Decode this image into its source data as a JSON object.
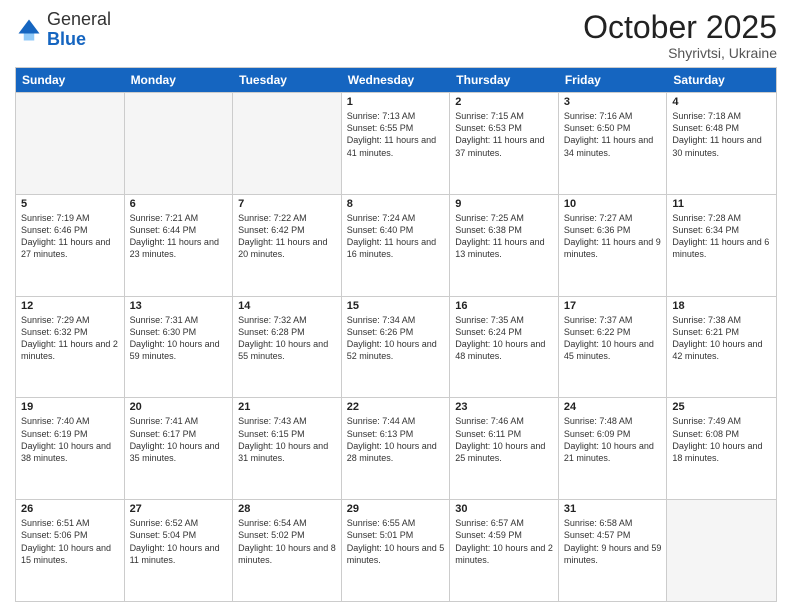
{
  "logo": {
    "general": "General",
    "blue": "Blue"
  },
  "header": {
    "month": "October 2025",
    "location": "Shyrivtsi, Ukraine"
  },
  "days": [
    "Sunday",
    "Monday",
    "Tuesday",
    "Wednesday",
    "Thursday",
    "Friday",
    "Saturday"
  ],
  "rows": [
    [
      {
        "day": "",
        "empty": true
      },
      {
        "day": "",
        "empty": true
      },
      {
        "day": "",
        "empty": true
      },
      {
        "day": "1",
        "sunrise": "Sunrise: 7:13 AM",
        "sunset": "Sunset: 6:55 PM",
        "daylight": "Daylight: 11 hours and 41 minutes."
      },
      {
        "day": "2",
        "sunrise": "Sunrise: 7:15 AM",
        "sunset": "Sunset: 6:53 PM",
        "daylight": "Daylight: 11 hours and 37 minutes."
      },
      {
        "day": "3",
        "sunrise": "Sunrise: 7:16 AM",
        "sunset": "Sunset: 6:50 PM",
        "daylight": "Daylight: 11 hours and 34 minutes."
      },
      {
        "day": "4",
        "sunrise": "Sunrise: 7:18 AM",
        "sunset": "Sunset: 6:48 PM",
        "daylight": "Daylight: 11 hours and 30 minutes."
      }
    ],
    [
      {
        "day": "5",
        "sunrise": "Sunrise: 7:19 AM",
        "sunset": "Sunset: 6:46 PM",
        "daylight": "Daylight: 11 hours and 27 minutes."
      },
      {
        "day": "6",
        "sunrise": "Sunrise: 7:21 AM",
        "sunset": "Sunset: 6:44 PM",
        "daylight": "Daylight: 11 hours and 23 minutes."
      },
      {
        "day": "7",
        "sunrise": "Sunrise: 7:22 AM",
        "sunset": "Sunset: 6:42 PM",
        "daylight": "Daylight: 11 hours and 20 minutes."
      },
      {
        "day": "8",
        "sunrise": "Sunrise: 7:24 AM",
        "sunset": "Sunset: 6:40 PM",
        "daylight": "Daylight: 11 hours and 16 minutes."
      },
      {
        "day": "9",
        "sunrise": "Sunrise: 7:25 AM",
        "sunset": "Sunset: 6:38 PM",
        "daylight": "Daylight: 11 hours and 13 minutes."
      },
      {
        "day": "10",
        "sunrise": "Sunrise: 7:27 AM",
        "sunset": "Sunset: 6:36 PM",
        "daylight": "Daylight: 11 hours and 9 minutes."
      },
      {
        "day": "11",
        "sunrise": "Sunrise: 7:28 AM",
        "sunset": "Sunset: 6:34 PM",
        "daylight": "Daylight: 11 hours and 6 minutes."
      }
    ],
    [
      {
        "day": "12",
        "sunrise": "Sunrise: 7:29 AM",
        "sunset": "Sunset: 6:32 PM",
        "daylight": "Daylight: 11 hours and 2 minutes."
      },
      {
        "day": "13",
        "sunrise": "Sunrise: 7:31 AM",
        "sunset": "Sunset: 6:30 PM",
        "daylight": "Daylight: 10 hours and 59 minutes."
      },
      {
        "day": "14",
        "sunrise": "Sunrise: 7:32 AM",
        "sunset": "Sunset: 6:28 PM",
        "daylight": "Daylight: 10 hours and 55 minutes."
      },
      {
        "day": "15",
        "sunrise": "Sunrise: 7:34 AM",
        "sunset": "Sunset: 6:26 PM",
        "daylight": "Daylight: 10 hours and 52 minutes."
      },
      {
        "day": "16",
        "sunrise": "Sunrise: 7:35 AM",
        "sunset": "Sunset: 6:24 PM",
        "daylight": "Daylight: 10 hours and 48 minutes."
      },
      {
        "day": "17",
        "sunrise": "Sunrise: 7:37 AM",
        "sunset": "Sunset: 6:22 PM",
        "daylight": "Daylight: 10 hours and 45 minutes."
      },
      {
        "day": "18",
        "sunrise": "Sunrise: 7:38 AM",
        "sunset": "Sunset: 6:21 PM",
        "daylight": "Daylight: 10 hours and 42 minutes."
      }
    ],
    [
      {
        "day": "19",
        "sunrise": "Sunrise: 7:40 AM",
        "sunset": "Sunset: 6:19 PM",
        "daylight": "Daylight: 10 hours and 38 minutes."
      },
      {
        "day": "20",
        "sunrise": "Sunrise: 7:41 AM",
        "sunset": "Sunset: 6:17 PM",
        "daylight": "Daylight: 10 hours and 35 minutes."
      },
      {
        "day": "21",
        "sunrise": "Sunrise: 7:43 AM",
        "sunset": "Sunset: 6:15 PM",
        "daylight": "Daylight: 10 hours and 31 minutes."
      },
      {
        "day": "22",
        "sunrise": "Sunrise: 7:44 AM",
        "sunset": "Sunset: 6:13 PM",
        "daylight": "Daylight: 10 hours and 28 minutes."
      },
      {
        "day": "23",
        "sunrise": "Sunrise: 7:46 AM",
        "sunset": "Sunset: 6:11 PM",
        "daylight": "Daylight: 10 hours and 25 minutes."
      },
      {
        "day": "24",
        "sunrise": "Sunrise: 7:48 AM",
        "sunset": "Sunset: 6:09 PM",
        "daylight": "Daylight: 10 hours and 21 minutes."
      },
      {
        "day": "25",
        "sunrise": "Sunrise: 7:49 AM",
        "sunset": "Sunset: 6:08 PM",
        "daylight": "Daylight: 10 hours and 18 minutes."
      }
    ],
    [
      {
        "day": "26",
        "sunrise": "Sunrise: 6:51 AM",
        "sunset": "Sunset: 5:06 PM",
        "daylight": "Daylight: 10 hours and 15 minutes."
      },
      {
        "day": "27",
        "sunrise": "Sunrise: 6:52 AM",
        "sunset": "Sunset: 5:04 PM",
        "daylight": "Daylight: 10 hours and 11 minutes."
      },
      {
        "day": "28",
        "sunrise": "Sunrise: 6:54 AM",
        "sunset": "Sunset: 5:02 PM",
        "daylight": "Daylight: 10 hours and 8 minutes."
      },
      {
        "day": "29",
        "sunrise": "Sunrise: 6:55 AM",
        "sunset": "Sunset: 5:01 PM",
        "daylight": "Daylight: 10 hours and 5 minutes."
      },
      {
        "day": "30",
        "sunrise": "Sunrise: 6:57 AM",
        "sunset": "Sunset: 4:59 PM",
        "daylight": "Daylight: 10 hours and 2 minutes."
      },
      {
        "day": "31",
        "sunrise": "Sunrise: 6:58 AM",
        "sunset": "Sunset: 4:57 PM",
        "daylight": "Daylight: 9 hours and 59 minutes."
      },
      {
        "day": "",
        "empty": true
      }
    ]
  ]
}
